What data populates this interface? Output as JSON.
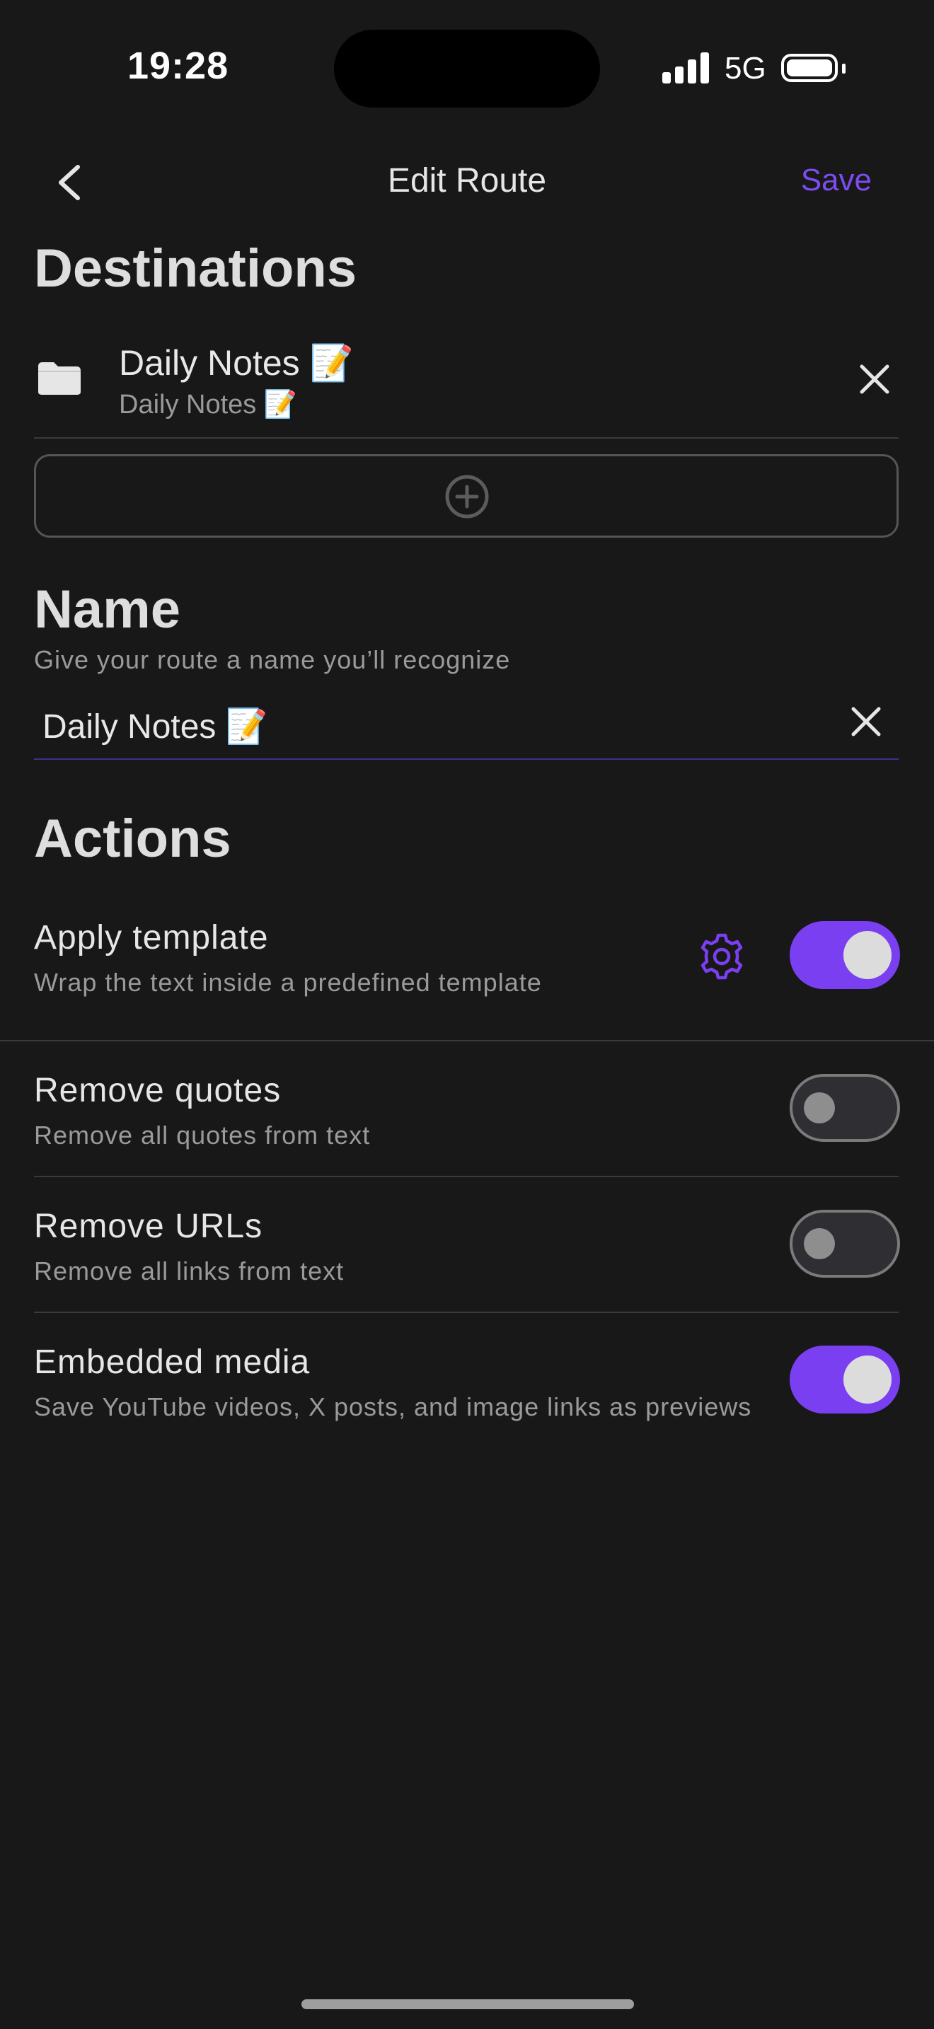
{
  "status_bar": {
    "time": "19:28",
    "network": "5G"
  },
  "nav": {
    "title": "Edit Route",
    "save_label": "Save"
  },
  "destinations": {
    "title": "Destinations",
    "items": [
      {
        "title": "Daily Notes 📝",
        "subtitle": "Daily Notes 📝"
      }
    ]
  },
  "name": {
    "title": "Name",
    "hint": "Give your route a name you’ll recognize",
    "value": "Daily Notes 📝"
  },
  "actions": {
    "title": "Actions",
    "items": [
      {
        "title": "Apply template",
        "subtitle": "Wrap the text inside a predefined template",
        "enabled": true
      },
      {
        "title": "Remove quotes",
        "subtitle": "Remove all quotes from text",
        "enabled": false
      },
      {
        "title": "Remove URLs",
        "subtitle": "Remove all links from text",
        "enabled": false
      },
      {
        "title": "Embedded media",
        "subtitle": "Save YouTube videos, X posts, and image links as previews",
        "enabled": true
      }
    ]
  },
  "colors": {
    "accent": "#7b3ff2",
    "background": "#181818"
  }
}
